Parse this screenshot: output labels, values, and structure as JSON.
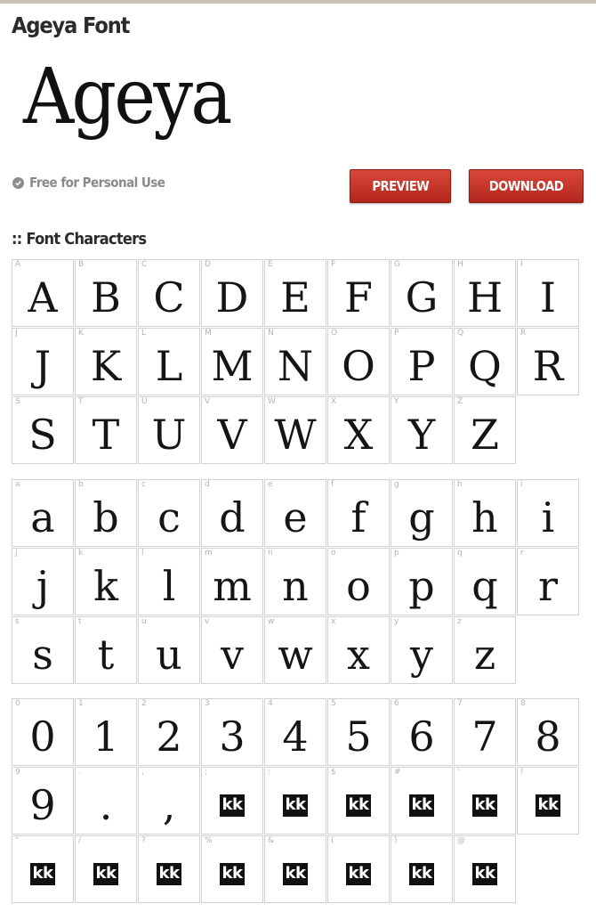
{
  "page": {
    "title": "Ageya Font"
  },
  "preview": {
    "sample_text": "Ageya"
  },
  "license": {
    "label": "Free for Personal Use",
    "icon": "check-circle-icon"
  },
  "buttons": {
    "preview": "PREVIEW",
    "download": "DOWNLOAD"
  },
  "colors": {
    "button_red": "#c7342a",
    "title_dark": "#2b2b2b",
    "muted_gray": "#8a8a8a",
    "cell_border": "#d2d2d2"
  },
  "characters": {
    "title": ":: Font Characters",
    "uppercase": [
      {
        "key": "A",
        "glyph": "A"
      },
      {
        "key": "B",
        "glyph": "B"
      },
      {
        "key": "C",
        "glyph": "C"
      },
      {
        "key": "D",
        "glyph": "D"
      },
      {
        "key": "E",
        "glyph": "E"
      },
      {
        "key": "F",
        "glyph": "F"
      },
      {
        "key": "G",
        "glyph": "G"
      },
      {
        "key": "H",
        "glyph": "H"
      },
      {
        "key": "I",
        "glyph": "I"
      },
      {
        "key": "J",
        "glyph": "J"
      },
      {
        "key": "K",
        "glyph": "K"
      },
      {
        "key": "L",
        "glyph": "L"
      },
      {
        "key": "M",
        "glyph": "M"
      },
      {
        "key": "N",
        "glyph": "N"
      },
      {
        "key": "O",
        "glyph": "O"
      },
      {
        "key": "P",
        "glyph": "P"
      },
      {
        "key": "Q",
        "glyph": "Q"
      },
      {
        "key": "R",
        "glyph": "R"
      },
      {
        "key": "S",
        "glyph": "S"
      },
      {
        "key": "T",
        "glyph": "T"
      },
      {
        "key": "U",
        "glyph": "U"
      },
      {
        "key": "V",
        "glyph": "V"
      },
      {
        "key": "W",
        "glyph": "W"
      },
      {
        "key": "X",
        "glyph": "X"
      },
      {
        "key": "Y",
        "glyph": "Y"
      },
      {
        "key": "Z",
        "glyph": "Z"
      }
    ],
    "lowercase": [
      {
        "key": "a",
        "glyph": "a"
      },
      {
        "key": "b",
        "glyph": "b"
      },
      {
        "key": "c",
        "glyph": "c"
      },
      {
        "key": "d",
        "glyph": "d"
      },
      {
        "key": "e",
        "glyph": "e"
      },
      {
        "key": "f",
        "glyph": "f"
      },
      {
        "key": "g",
        "glyph": "g"
      },
      {
        "key": "h",
        "glyph": "h"
      },
      {
        "key": "i",
        "glyph": "i"
      },
      {
        "key": "j",
        "glyph": "j"
      },
      {
        "key": "k",
        "glyph": "k"
      },
      {
        "key": "l",
        "glyph": "l"
      },
      {
        "key": "m",
        "glyph": "m"
      },
      {
        "key": "n",
        "glyph": "n"
      },
      {
        "key": "o",
        "glyph": "o"
      },
      {
        "key": "p",
        "glyph": "p"
      },
      {
        "key": "q",
        "glyph": "q"
      },
      {
        "key": "r",
        "glyph": "r"
      },
      {
        "key": "s",
        "glyph": "s"
      },
      {
        "key": "t",
        "glyph": "t"
      },
      {
        "key": "u",
        "glyph": "u"
      },
      {
        "key": "v",
        "glyph": "v"
      },
      {
        "key": "w",
        "glyph": "w"
      },
      {
        "key": "x",
        "glyph": "x"
      },
      {
        "key": "y",
        "glyph": "y"
      },
      {
        "key": "z",
        "glyph": "z"
      }
    ],
    "symbols": [
      {
        "key": "0",
        "glyph": "0"
      },
      {
        "key": "1",
        "glyph": "1"
      },
      {
        "key": "2",
        "glyph": "2"
      },
      {
        "key": "3",
        "glyph": "3"
      },
      {
        "key": "4",
        "glyph": "4"
      },
      {
        "key": "5",
        "glyph": "5"
      },
      {
        "key": "6",
        "glyph": "6"
      },
      {
        "key": "7",
        "glyph": "7"
      },
      {
        "key": "8",
        "glyph": "8"
      },
      {
        "key": "9",
        "glyph": "9"
      },
      {
        "key": ".",
        "glyph": "."
      },
      {
        "key": ",",
        "glyph": ","
      },
      {
        "key": ";",
        "glyph": "kk",
        "missing": true
      },
      {
        "key": ":",
        "glyph": "kk",
        "missing": true
      },
      {
        "key": "$",
        "glyph": "kk",
        "missing": true
      },
      {
        "key": "#",
        "glyph": "kk",
        "missing": true
      },
      {
        "key": "'",
        "glyph": "kk",
        "missing": true
      },
      {
        "key": "!",
        "glyph": "kk",
        "missing": true
      },
      {
        "key": "\"",
        "glyph": "kk",
        "missing": true
      },
      {
        "key": "/",
        "glyph": "kk",
        "missing": true
      },
      {
        "key": "?",
        "glyph": "kk",
        "missing": true
      },
      {
        "key": "%",
        "glyph": "kk",
        "missing": true
      },
      {
        "key": "&",
        "glyph": "kk",
        "missing": true
      },
      {
        "key": "(",
        "glyph": "kk",
        "missing": true
      },
      {
        "key": ")",
        "glyph": "kk",
        "missing": true
      },
      {
        "key": "@",
        "glyph": "kk",
        "missing": true
      }
    ]
  }
}
